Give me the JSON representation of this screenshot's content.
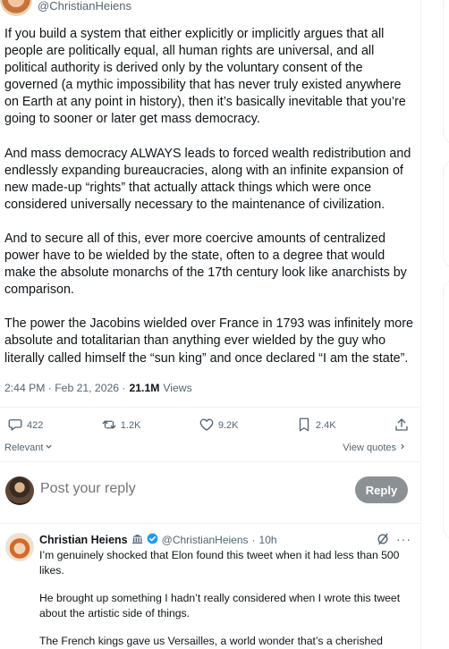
{
  "tweet": {
    "handle": "@ChristianHeiens",
    "paragraphs": [
      "If you build a system that either explicitly or implicitly argues that all people are politically equal, all human rights are universal, and all political authority is derived only by the voluntary consent of the governed (a mythic impossibility that has never truly existed anywhere on Earth at any point in history), then it’s basically inevitable that you’re going to sooner or later get mass democracy.",
      "And mass democracy ALWAYS leads to forced wealth redistribution and endlessly expanding bureaucracies, along with an infinite expansion of new made-up “rights” that actually attack things which were once considered universally necessary to the maintenance of civilization.",
      "And to secure all of this, ever more coercive amounts of centralized power have to be wielded by the state, often to a degree that would make the absolute monarchs of the 17th century look like anarchists by comparison.",
      "The power the Jacobins wielded over France in 1793 was infinitely more absolute and totalitarian than anything ever wielded by the guy who literally called himself the “sun king” and once declared “I am the state”."
    ],
    "timestamp": "2:44 PM · Feb 21, 2026 · ",
    "views_count": "21.1M",
    "views_label": " Views"
  },
  "actions": {
    "replies": "422",
    "reposts": "1.2K",
    "likes": "9.2K",
    "bookmarks": "2.4K"
  },
  "sort": {
    "label": "Relevant",
    "view_quotes": "View quotes"
  },
  "composer": {
    "placeholder": "Post your reply",
    "button": "Reply"
  },
  "reply": {
    "name": "Christian Heiens",
    "handle": "@ChristianHeiens",
    "separator": "·",
    "time": "10h",
    "paragraphs": [
      "I’m genuinely shocked that Elon found this tweet when it had less than 500 likes.",
      "He brought up something I hadn’t really considered when I wrote this tweet about the artistic side of things.",
      "The French kings gave us Versailles, a world wonder that’s a cherished"
    ]
  },
  "icons": {
    "reply": "speech-bubble-icon",
    "repost": "repost-arrows-icon",
    "like": "heart-icon",
    "bookmark": "bookmark-icon",
    "share": "share-upload-icon",
    "grok": "grok-slash-icon",
    "more": "more-dots-icon",
    "verified": "verified-badge-icon",
    "bank": "bank-building-icon"
  },
  "colors": {
    "text": "#0f1419",
    "secondary": "#536471",
    "border": "#eff3f4",
    "verified": "#1d9bf0",
    "reply_button": "#8b9095"
  }
}
